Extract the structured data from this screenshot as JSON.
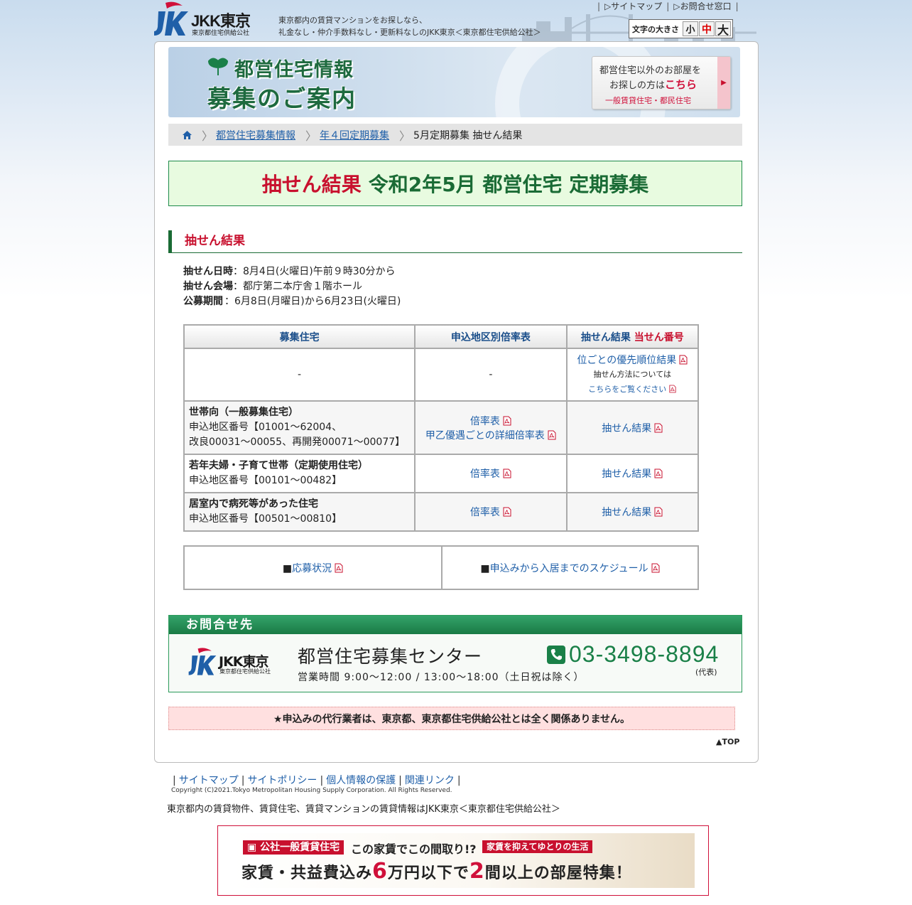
{
  "header": {
    "logo_text": "JKK東京",
    "logo_sub": "東京都住宅供給公社",
    "tagline_1": "東京都内の賃貸マンションをお探しなら、",
    "tagline_2": "礼金なし・仲介手数料なし・更新料なしのJKK東京＜東京都住宅供給公社＞",
    "sitemap": "サイトマップ",
    "contact": "お問合せ窓口",
    "font_size_label": "文字の大きさ",
    "font_small": "小",
    "font_medium": "中",
    "font_large": "大"
  },
  "banner": {
    "title_1": "都営住宅情報",
    "title_2": "募集のご案内",
    "side_line1": "都営住宅以外のお部屋を",
    "side_line2a": "お探しの方は",
    "side_line2b": "こちら",
    "side_line3": "一般賃貸住宅・都民住宅"
  },
  "breadcrumb": {
    "items": [
      "都営住宅募集情報",
      "年４回定期募集"
    ],
    "current": "5月定期募集 抽せん結果"
  },
  "page_title": {
    "red": "抽せん結果",
    "green": "令和2年5月 都営住宅 定期募集"
  },
  "section_heading": "抽せん結果",
  "info": {
    "date_label": "抽せん日時",
    "date_value": "：8月4日(火曜日)午前９時30分から",
    "venue_label": "抽せん会場",
    "venue_value": "：都庁第二本庁舎１階ホール",
    "period_label": "公募期間",
    "period_value": "：6月8日(月曜日)から6月23日(火曜日)"
  },
  "table": {
    "headers": {
      "col1": "募集住宅",
      "col2": "申込地区別倍率表",
      "col3a": "抽せん結果",
      "col3b": "当せん番号"
    },
    "row0": {
      "col1": "-",
      "col2": "-",
      "link1": "位ごとの優先順位結果",
      "note1": "抽せん方法については",
      "note2": "こちらをご覧ください"
    },
    "row1": {
      "title": "世帯向（一般募集住宅）",
      "line2": "申込地区番号【01001～62004、",
      "line3": "改良00031～00055、再開発00071～00077】",
      "rate": "倍率表",
      "rate_detail": "甲乙優遇ごとの詳細倍率表",
      "result": "抽せん結果"
    },
    "row2": {
      "title": "若年夫婦・子育て世帯（定期使用住宅）",
      "line2": "申込地区番号【00101～00482】",
      "rate": "倍率表",
      "result": "抽せん結果"
    },
    "row3": {
      "title": "居室内で病死等があった住宅",
      "line2": "申込地区番号【00501～00810】",
      "rate": "倍率表",
      "result": "抽せん結果"
    }
  },
  "sub_links": {
    "bullet": "■",
    "status": "応募状況",
    "schedule": "申込みから入居までのスケジュール"
  },
  "contact": {
    "heading": "お問合せ先",
    "logo_text": "JKK東京",
    "logo_sub": "東京都住宅供給公社",
    "center": "都営住宅募集センター",
    "hours": "営業時間 9:00～12:00 / 13:00～18:00（土日祝は除く）",
    "tel": "03-3498-8894",
    "tel_note": "(代表)"
  },
  "notice": "★申込みの代行業者は、東京都、東京都住宅供給公社とは全く関係ありません。",
  "to_top": "▲TOP",
  "footer": {
    "links": [
      "サイトマップ",
      "サイトポリシー",
      "個人情報の保護",
      "関連リンク"
    ],
    "copyright": "Copyright (C)2021.Tokyo Metropolitan Housing Supply Corporation. All Rights Reserved.",
    "tagline": "東京都内の賃貸物件、賃貸住宅、賃貸マンションの賃貸情報はJKK東京＜東京都住宅供給公社＞"
  },
  "ad": {
    "tag1": "公社一般賃貸住宅",
    "question": "この家賃でこの間取り!?",
    "tag2": "家賃を抑えてゆとりの生活",
    "main_a": "家賃・共益費込み",
    "main_num1": "6",
    "main_b": "万円以下で",
    "main_num2": "2",
    "main_c": "間以上の部屋特集！"
  },
  "colors": {
    "brand_green": "#1a6b35",
    "accent_red": "#c8102e",
    "link_blue": "#1f5fa8"
  }
}
